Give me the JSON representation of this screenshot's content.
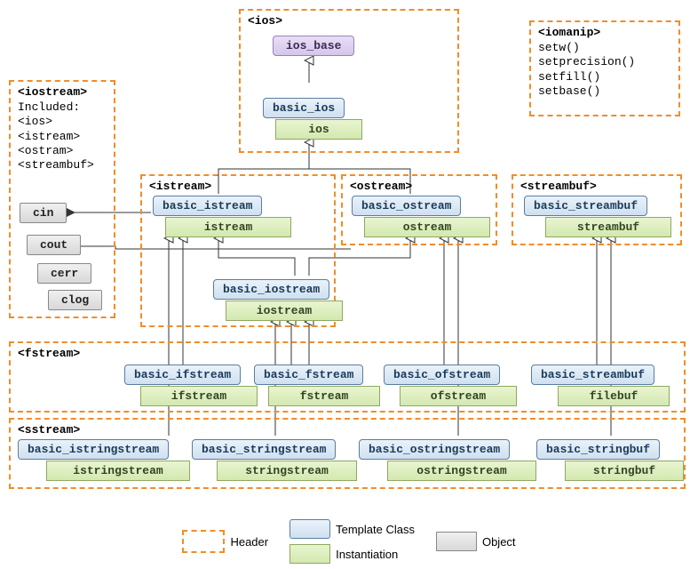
{
  "headers": {
    "ios": "<ios>",
    "iomanip": "<iomanip>",
    "iostream": "<iostream>",
    "istream": "<istream>",
    "ostream": "<ostream>",
    "streambuf": "<streambuf>",
    "fstream": "<fstream>",
    "sstream": "<sstream>"
  },
  "iosbase": "ios_base",
  "templates": {
    "basic_ios": "basic_ios",
    "basic_istream": "basic_istream",
    "basic_ostream": "basic_ostream",
    "basic_iostream": "basic_iostream",
    "basic_streambuf": "basic_streambuf",
    "basic_ifstream": "basic_ifstream",
    "basic_fstream": "basic_fstream",
    "basic_ofstream": "basic_ofstream",
    "basic_filebuf": "basic_streambuf",
    "basic_istringstream": "basic_istringstream",
    "basic_stringstream": "basic_stringstream",
    "basic_ostringstream": "basic_ostringstream",
    "basic_stringbuf": "basic_stringbuf"
  },
  "inst": {
    "ios": "ios",
    "istream": "istream",
    "ostream": "ostream",
    "iostream": "iostream",
    "streambuf": "streambuf",
    "ifstream": "ifstream",
    "fstream": "fstream",
    "ofstream": "ofstream",
    "filebuf": "filebuf",
    "istringstream": "istringstream",
    "stringstream": "stringstream",
    "ostringstream": "ostringstream",
    "stringbuf": "stringbuf"
  },
  "objects": {
    "cin": "cin",
    "cout": "cout",
    "cerr": "cerr",
    "clog": "clog"
  },
  "iostream_text": {
    "line1": "Included:",
    "line2": "<ios>",
    "line3": "<istream>",
    "line4": "<ostram>",
    "line5": "<streambuf>"
  },
  "iomanip_text": {
    "l1": "setw()",
    "l2": "setprecision()",
    "l3": "setfill()",
    "l4": "setbase()"
  },
  "legend": {
    "header": "Header",
    "template": "Template Class",
    "inst": "Instantiation",
    "object": "Object"
  }
}
